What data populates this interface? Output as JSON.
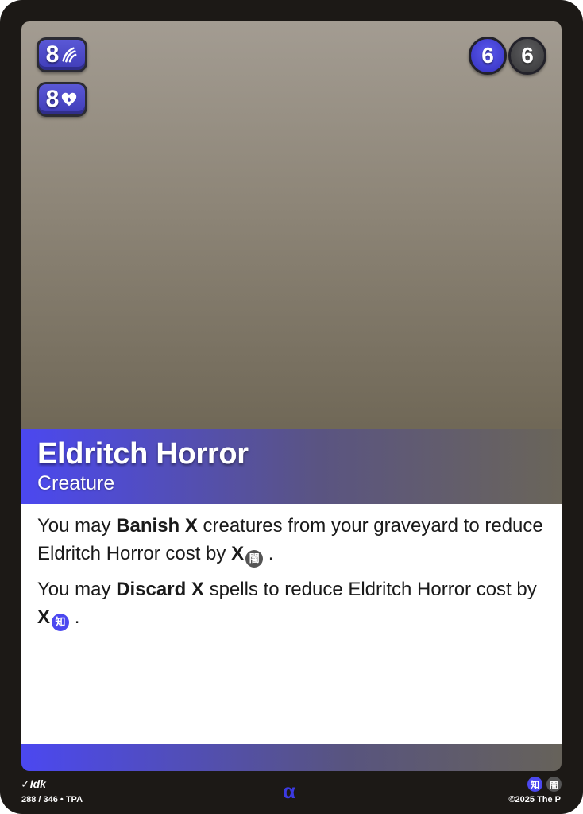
{
  "card": {
    "name": "Eldritch Horror",
    "type": "Creature",
    "stats": [
      {
        "value": "8",
        "icon": "claw-slash-icon"
      },
      {
        "value": "8",
        "icon": "heart-drop-icon"
      }
    ],
    "costs": [
      {
        "value": "6",
        "color": "#4b48f0"
      },
      {
        "value": "6",
        "color": "#4a4a4c"
      }
    ],
    "abilities": [
      {
        "pre": "You may ",
        "bold": "Banish X",
        "mid": " creatures from your graveyard to reduce Eldritch Horror cost by ",
        "x": "X",
        "glyph": "闇",
        "post": "."
      },
      {
        "pre": "You may ",
        "bold": "Discard X",
        "mid": " spells to reduce Eldritch Horror cost by ",
        "x": "X",
        "glyph": "知",
        "post": "."
      }
    ]
  },
  "footer": {
    "artist": "Idk",
    "artist_mark": "✓",
    "set_info": "288 / 346 • TPA",
    "rarity": "α",
    "elements": [
      "知",
      "闇"
    ],
    "copyright": "©2025 The P"
  },
  "colors": {
    "accent": "#4b48f0",
    "dark_element": "#555555",
    "frame": "#1c1916"
  }
}
